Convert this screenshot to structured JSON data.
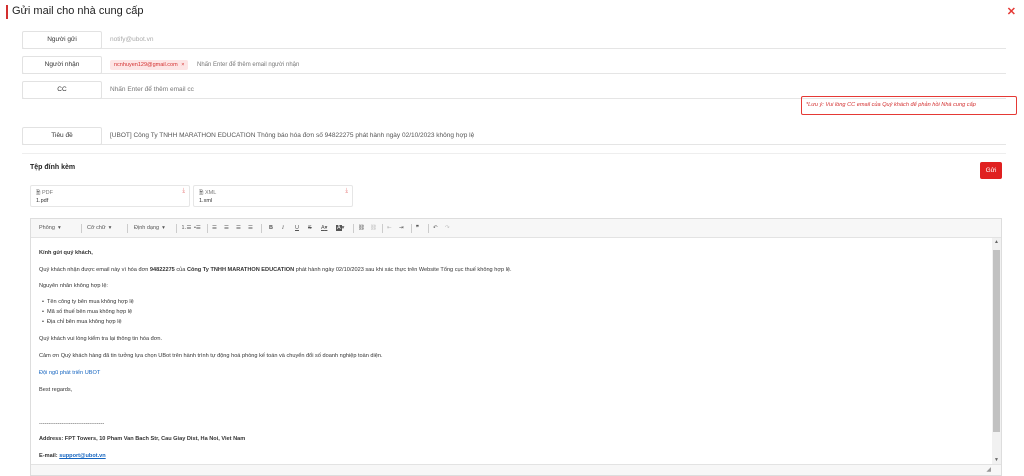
{
  "header": {
    "title": "Gửi mail cho nhà cung cấp",
    "close": "✕"
  },
  "sender": {
    "label": "Người gửi",
    "value": "notify@ubot.vn"
  },
  "recipient": {
    "label": "Người nhận",
    "chip": "ncnhuyen129@gmail.com",
    "chip_remove": "×",
    "placeholder": "Nhấn Enter để thêm email người nhận"
  },
  "cc": {
    "label": "CC",
    "placeholder": "Nhấn Enter để thêm email cc"
  },
  "note": "*Lưu ý: Vui lòng CC email của Quý khách để phản hồi Nhà cung cấp",
  "subject": {
    "label": "Tiêu đề",
    "value": "[UBOT] Công Ty TNHH MARATHON EDUCATION Thông báo hóa đơn số 94822275 phát hành ngày 02/10/2023 không hợp lệ"
  },
  "attachments": {
    "title": "Tệp đính kèm",
    "send": "Gửi",
    "files": [
      {
        "type": "PDF",
        "name": "1.pdf"
      },
      {
        "type": "XML",
        "name": "1.xml"
      }
    ]
  },
  "toolbar": {
    "style": "Phông",
    "size": "Cỡ chữ",
    "format": "Định dạng",
    "bold": "B",
    "italic": "I",
    "underline": "U",
    "strike": "S",
    "font_color": "A",
    "bg_color": "A",
    "quote": "❞",
    "undo": "↶",
    "redo": "↷"
  },
  "body": {
    "greeting": "Kính gửi quý khách,",
    "p1_pre": "Quý khách nhận được email này vì hóa đơn ",
    "p1_invoice": "94822275",
    "p1_mid": " của ",
    "p1_company": "Công Ty TNHH MARATHON EDUCATION",
    "p1_post": " phát hành ngày 02/10/2023 sau khi xác thực trên Website Tổng cục thuế không hợp lệ.",
    "reason_title": "Nguyên nhân không hợp lệ:",
    "reasons": [
      "Tên công ty bên mua không hợp lệ",
      "Mã số thuế bên mua không hợp lệ",
      "Địa chỉ bên mua không hợp lệ"
    ],
    "check": "Quý khách vui lòng kiểm tra lại thông tin hóa đơn.",
    "thanks": "Cảm ơn Quý khách hàng đã tin tưởng lựa chọn UBot trên hành trình tự động hoá phòng kế toán và chuyển đổi số doanh nghiệp toàn diện.",
    "team": "Đội ngũ phát triển UBOT",
    "regards": "Best regards,",
    "divider": "-----------------------------------",
    "address": "Address: FPT Towers, 10 Pham Van Bach Str, Cau Giay Dist, Ha Noi, Viet Nam",
    "email_label": "E-mail: ",
    "email": "support@ubot.vn"
  }
}
